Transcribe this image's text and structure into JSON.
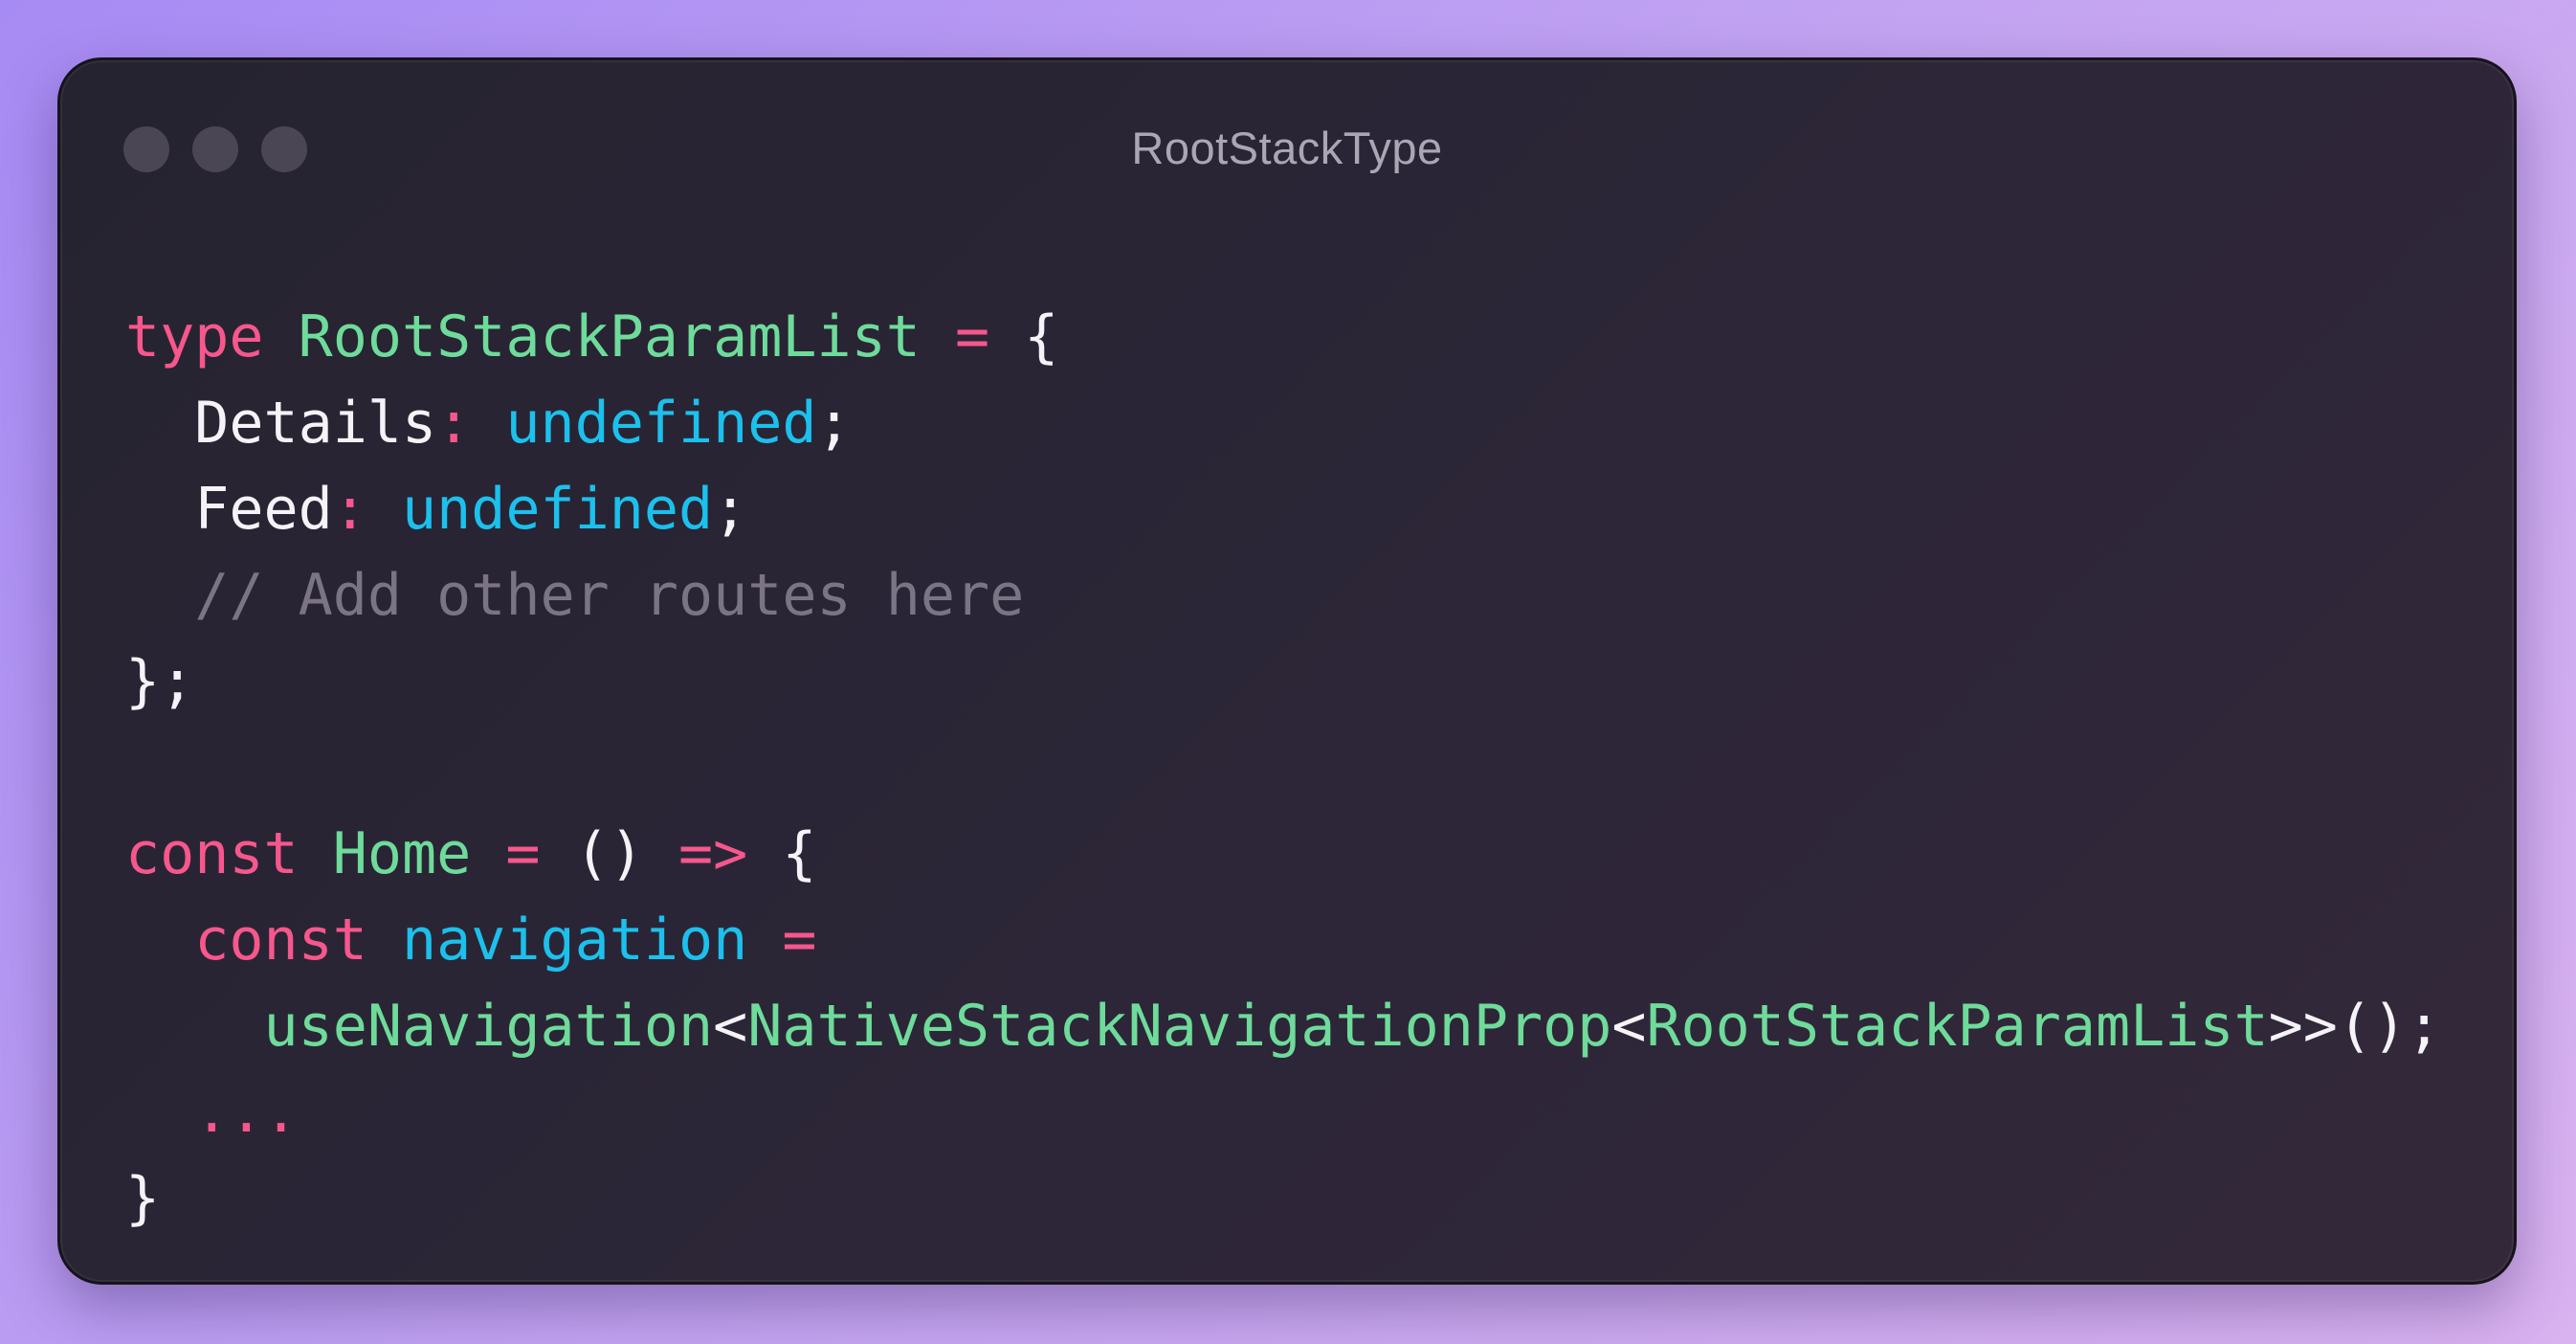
{
  "window": {
    "title": "RootStackType",
    "controls": [
      "close-dot",
      "minimize-dot",
      "zoom-dot"
    ]
  },
  "code": {
    "lines": [
      [
        "type",
        " ",
        "RootStackParamList",
        " ",
        "=",
        " ",
        "{"
      ],
      [
        "  ",
        "Details",
        ":",
        " ",
        "undefined",
        ";"
      ],
      [
        "  ",
        "Feed",
        ":",
        " ",
        "undefined",
        ";"
      ],
      [
        "  ",
        "// Add other routes here"
      ],
      [
        "};"
      ],
      [
        ""
      ],
      [
        "const",
        " ",
        "Home",
        " ",
        "=",
        " ",
        "()",
        " ",
        "=>",
        " ",
        "{"
      ],
      [
        "  ",
        "const",
        " ",
        "navigation",
        " ",
        "="
      ],
      [
        "    ",
        "useNavigation",
        "<",
        "NativeStackNavigationProp",
        "<",
        "RootStackParamList",
        ">>",
        "();"
      ],
      [
        "  ",
        "..."
      ],
      [
        "}"
      ]
    ]
  },
  "colors": {
    "keyword": "#f7578c",
    "type": "#6edb9a",
    "property": "#1cc0ec",
    "punctuation": "#f5f3f7",
    "comment": "#7a7484",
    "background": "#2a2533"
  }
}
